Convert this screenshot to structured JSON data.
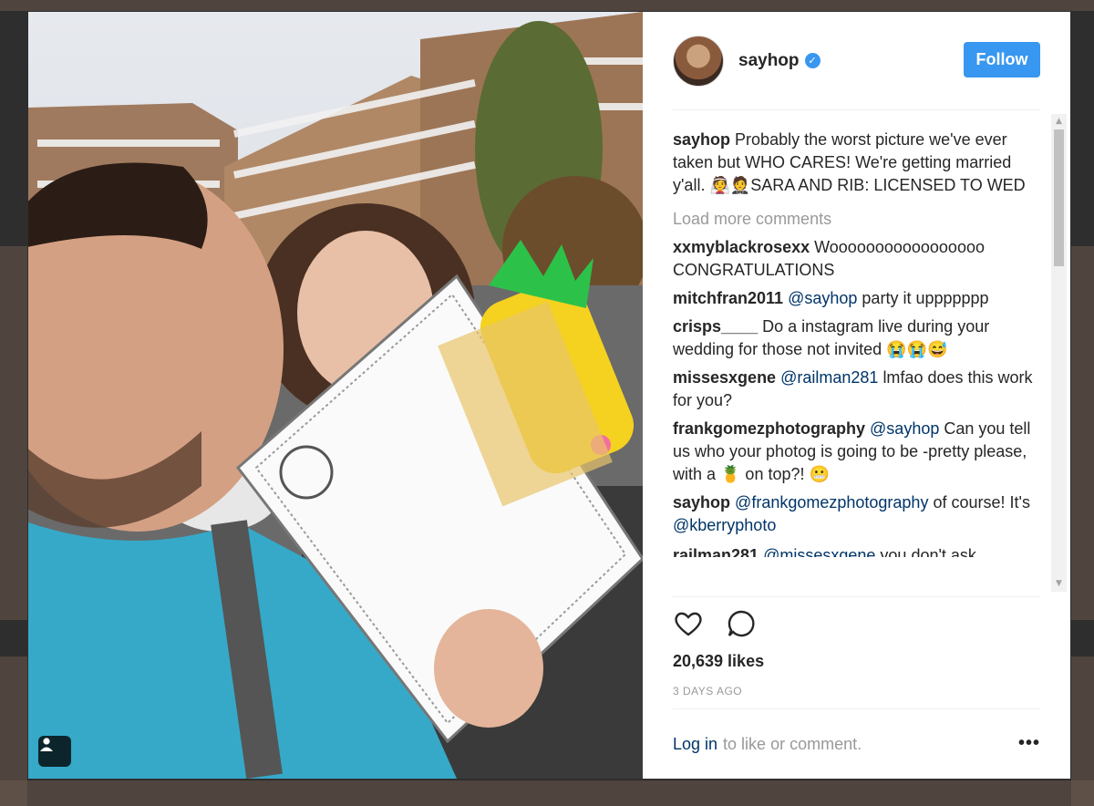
{
  "post": {
    "username": "sayhop",
    "follow_label": "Follow",
    "verified_symbol": "✓",
    "caption": {
      "user": "sayhop",
      "text": "Probably the worst picture we've ever taken but WHO CARES! We're getting married y'all. 👰🤵SARA AND RIB: LICENSED TO WED"
    },
    "load_more_label": "Load more comments",
    "comments": [
      {
        "user": "xxmyblackrosexx",
        "mention": "",
        "text": "Wooooooooooooooooo CONGRATULATIONS"
      },
      {
        "user": "mitchfran2011",
        "mention": "@sayhop",
        "text": "party it uppppppp"
      },
      {
        "user": "crisps____",
        "mention": "",
        "text": "Do a instagram live during your wedding for those not invited 😭😭😅"
      },
      {
        "user": "missesxgene",
        "mention": "@railman281",
        "text": "lmfao does this work for you?"
      },
      {
        "user": "frankgomezphotography",
        "mention": "@sayhop",
        "text": "Can you tell us who your photog is going to be -pretty please, with a 🍍 on top?! 😬"
      },
      {
        "user": "sayhop",
        "mention": "@frankgomezphotography",
        "text": "of course! It's",
        "mention2": "@kberryphoto"
      },
      {
        "user": "railman281",
        "mention": "@missesxgene",
        "text": "you don't ask"
      }
    ],
    "likes": "20,639 likes",
    "time_ago": "3 DAYS AGO",
    "login_link": "Log in",
    "login_suffix": "to like or comment.",
    "more_options": "•••"
  },
  "icons": [
    "heart-icon",
    "comment-icon",
    "person-tag-icon",
    "more-options-icon"
  ],
  "colors": {
    "accent": "#3897f0",
    "link": "#003569",
    "muted": "#999999",
    "text": "#262626",
    "overlay": "#2e2e2e"
  }
}
